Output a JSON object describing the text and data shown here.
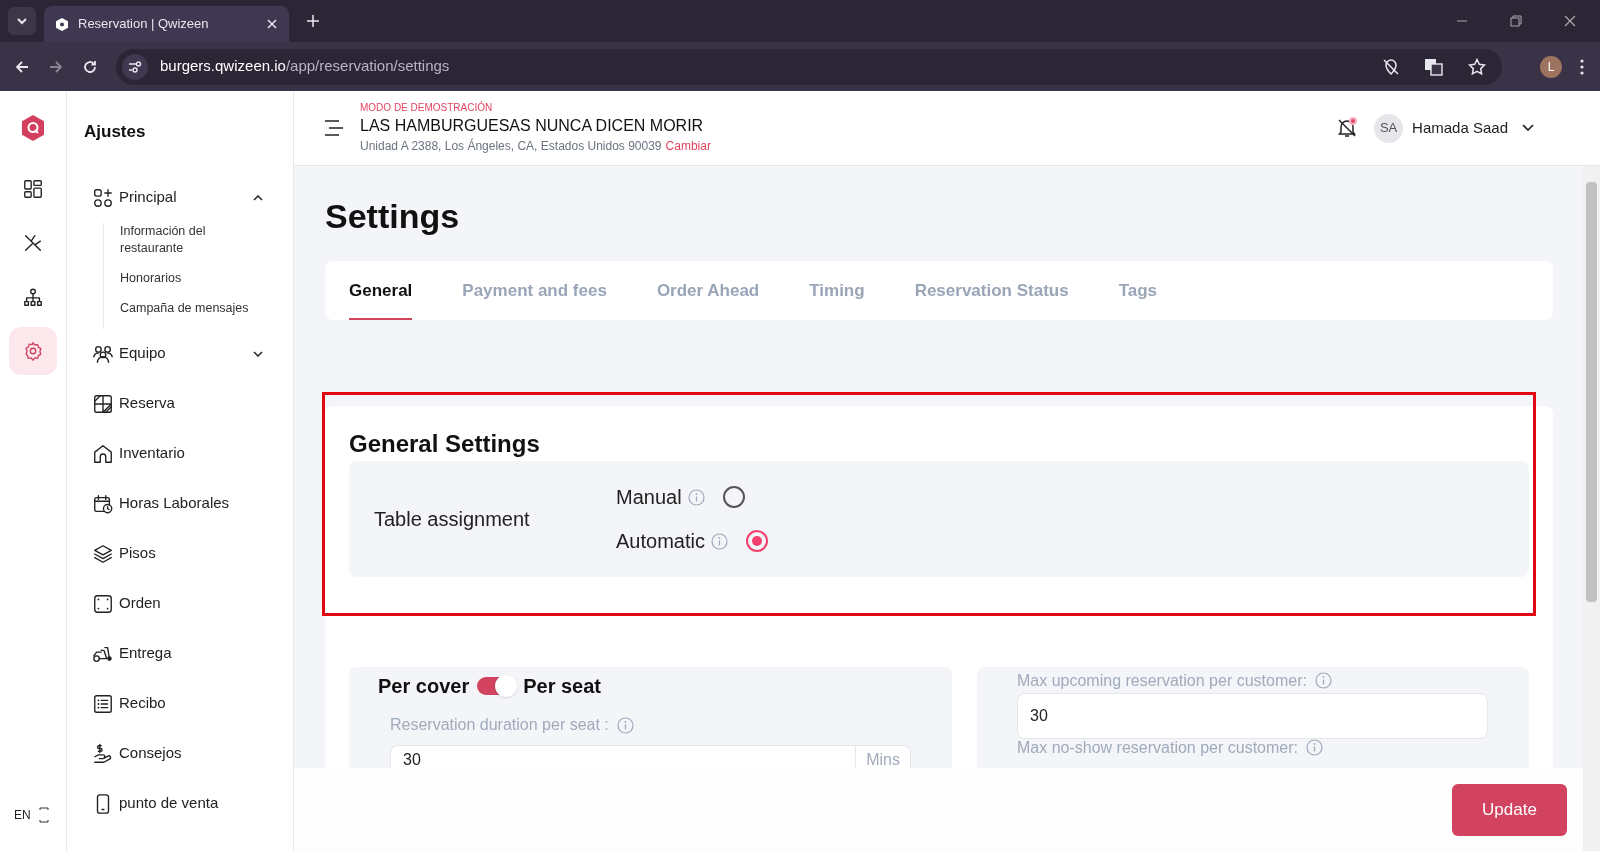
{
  "browser": {
    "tab_title": "Reservation | Qwizeen",
    "url_host": "burgers.qwizeen.io",
    "url_path": "/app/reservation/settings",
    "profile_initial": "L"
  },
  "rail": {
    "items": [
      {
        "selected": false
      },
      {
        "selected": false
      },
      {
        "selected": false
      },
      {
        "selected": true
      }
    ],
    "language": "EN"
  },
  "sidebar": {
    "title": "Ajustes",
    "items": [
      {
        "label": "Principal",
        "expanded": true,
        "children": [
          {
            "label": "Información del restaurante"
          },
          {
            "label": "Honorarios"
          },
          {
            "label": "Campaña de mensajes"
          }
        ]
      },
      {
        "label": "Equipo",
        "expanded": false
      },
      {
        "label": "Reserva"
      },
      {
        "label": "Inventario"
      },
      {
        "label": "Horas Laborales"
      },
      {
        "label": "Pisos"
      },
      {
        "label": "Orden"
      },
      {
        "label": "Entrega"
      },
      {
        "label": "Recibo"
      },
      {
        "label": "Consejos"
      },
      {
        "label": "punto de venta"
      }
    ]
  },
  "header": {
    "mode": "MODO DE DEMOSTRACIÓN",
    "restaurant": "LAS HAMBURGUESAS NUNCA DICEN MORIR",
    "address": "Unidad A 2388, Los Ángeles, CA, Estados Unidos 90039",
    "change_link": "Cambiar",
    "user_initials": "SA",
    "user_name": "Hamada Saad"
  },
  "page_title": "Settings",
  "tabs": [
    {
      "label": "General",
      "selected": true
    },
    {
      "label": "Payment and fees",
      "selected": false
    },
    {
      "label": "Order Ahead",
      "selected": false
    },
    {
      "label": "Timing",
      "selected": false
    },
    {
      "label": "Reservation Status",
      "selected": false
    },
    {
      "label": "Tags",
      "selected": false
    }
  ],
  "general_settings": {
    "title": "General Settings",
    "label": "Table assignment",
    "options": [
      {
        "label": "Manual",
        "selected": false
      },
      {
        "label": "Automatic",
        "selected": true
      }
    ]
  },
  "duration_card": {
    "left_label": "Per cover",
    "right_label": "Per seat",
    "toggle_on": true,
    "field_label": "Reservation duration per seat :",
    "value": "30",
    "unit": "Mins"
  },
  "limits_card": {
    "fields": [
      {
        "label": "Max upcoming reservation per customer:",
        "value": "30"
      },
      {
        "label": "Max no-show reservation per customer:"
      }
    ]
  },
  "update_button": "Update"
}
